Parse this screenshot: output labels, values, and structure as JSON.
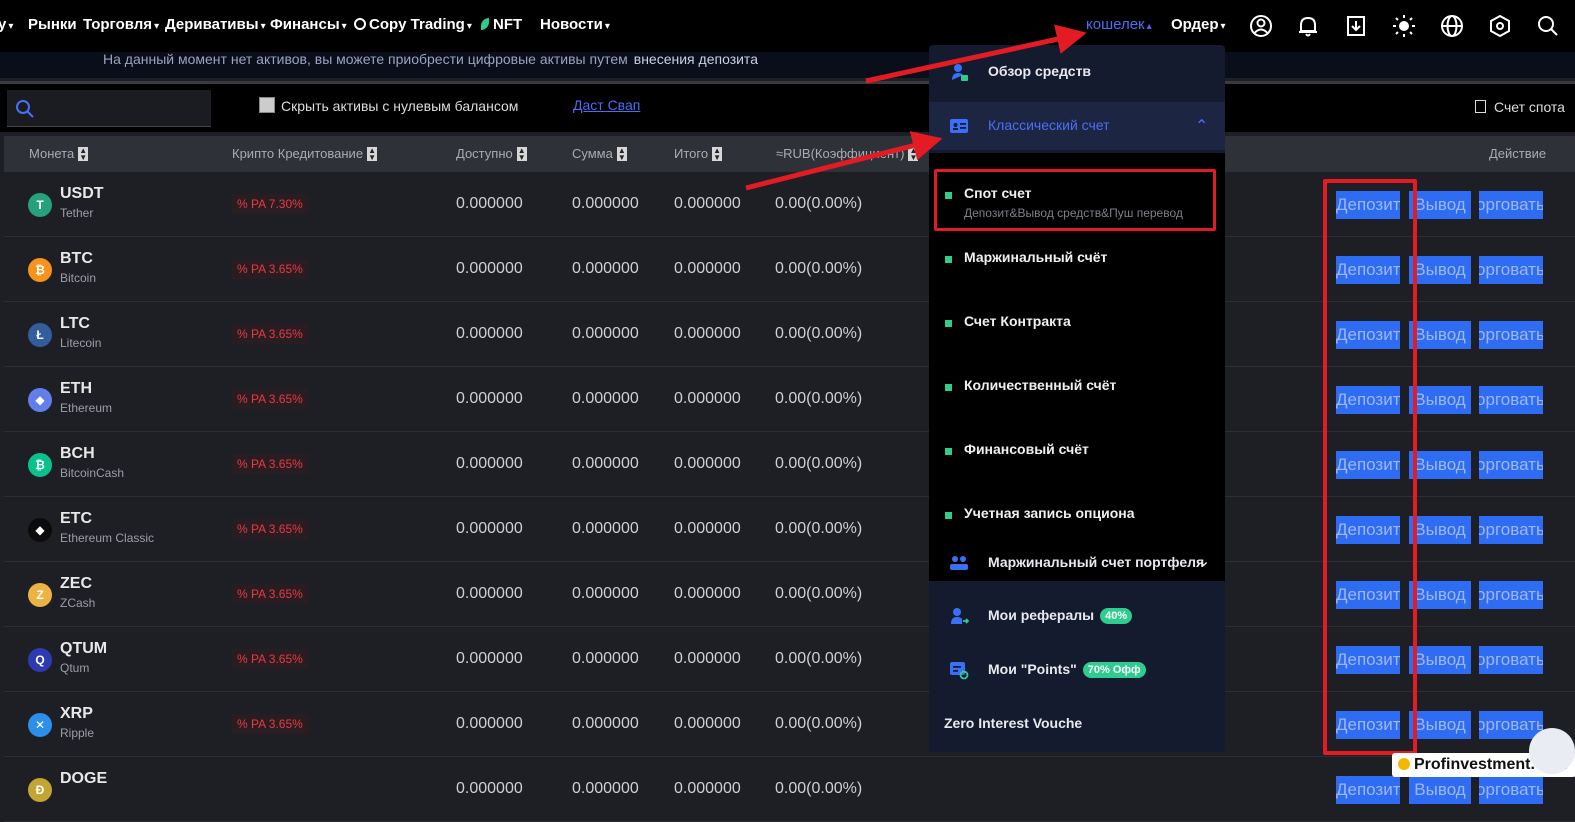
{
  "nav": {
    "items": [
      {
        "label": "у",
        "caret": "▾"
      },
      {
        "label": "Рынки",
        "caret": ""
      },
      {
        "label": "Торговля",
        "caret": "▾"
      },
      {
        "label": "Деривативы",
        "caret": "▾"
      },
      {
        "label": "Финансы",
        "caret": "▾"
      },
      {
        "label": "Copy Trading",
        "caret": "▾"
      },
      {
        "label": "NFT",
        "caret": ""
      },
      {
        "label": "Новости",
        "caret": "▾"
      }
    ],
    "wallet": "кошелек",
    "wallet_caret": "▴",
    "order": "Ордер",
    "order_caret": "▾",
    "icons": [
      "user-icon",
      "bell-icon",
      "download-icon",
      "theme-icon",
      "globe-icon",
      "settings-hex-icon",
      "search-icon"
    ]
  },
  "notice": {
    "text": "На данный момент нет активов, вы можете приобрести цифровые активы путем",
    "link": "внесения депозита"
  },
  "filters": {
    "search_placeholder": "",
    "hide_zero_label": "Скрыть активы с нулевым балансом",
    "dust_swap": "Даст Свап",
    "spot_account_link": "Счет спота"
  },
  "table": {
    "headers": {
      "coin": "Монета",
      "lending": "Крипто Кредитование",
      "available": "Доступно",
      "amount": "Сумма",
      "total": "Итого",
      "rub": "≈RUB(Коэффициент)",
      "action": "Действие"
    },
    "rows": [
      {
        "symbol": "USDT",
        "name": "Tether",
        "rate": "% PA 7.30%",
        "available": "0.000000",
        "amount": "0.000000",
        "total": "0.000000",
        "rub": "0.00(0.00%)",
        "icon_color": "#26a17b",
        "icon_glyph": "T"
      },
      {
        "symbol": "BTC",
        "name": "Bitcoin",
        "rate": "% PA 3.65%",
        "available": "0.000000",
        "amount": "0.000000",
        "total": "0.000000",
        "rub": "0.00(0.00%)",
        "icon_color": "#f7931a",
        "icon_glyph": "₿"
      },
      {
        "symbol": "LTC",
        "name": "Litecoin",
        "rate": "% PA 3.65%",
        "available": "0.000000",
        "amount": "0.000000",
        "total": "0.000000",
        "rub": "0.00(0.00%)",
        "icon_color": "#345d9d",
        "icon_glyph": "Ł"
      },
      {
        "symbol": "ETH",
        "name": "Ethereum",
        "rate": "% PA 3.65%",
        "available": "0.000000",
        "amount": "0.000000",
        "total": "0.000000",
        "rub": "0.00(0.00%)",
        "icon_color": "#627eea",
        "icon_glyph": "◆"
      },
      {
        "symbol": "BCH",
        "name": "BitcoinCash",
        "rate": "% PA 3.65%",
        "available": "0.000000",
        "amount": "0.000000",
        "total": "0.000000",
        "rub": "0.00(0.00%)",
        "icon_color": "#0ac18e",
        "icon_glyph": "₿"
      },
      {
        "symbol": "ETC",
        "name": "Ethereum Classic",
        "rate": "% PA 3.65%",
        "available": "0.000000",
        "amount": "0.000000",
        "total": "0.000000",
        "rub": "0.00(0.00%)",
        "icon_color": "#0b0b0b",
        "icon_glyph": "◆"
      },
      {
        "symbol": "ZEC",
        "name": "ZCash",
        "rate": "% PA 3.65%",
        "available": "0.000000",
        "amount": "0.000000",
        "total": "0.000000",
        "rub": "0.00(0.00%)",
        "icon_color": "#ecb244",
        "icon_glyph": "Z"
      },
      {
        "symbol": "QTUM",
        "name": "Qtum",
        "rate": "% PA 3.65%",
        "available": "0.000000",
        "amount": "0.000000",
        "total": "0.000000",
        "rub": "0.00(0.00%)",
        "icon_color": "#2e3bb0",
        "icon_glyph": "Q"
      },
      {
        "symbol": "XRP",
        "name": "Ripple",
        "rate": "% PA 3.65%",
        "available": "0.000000",
        "amount": "0.000000",
        "total": "0.000000",
        "rub": "0.00(0.00%)",
        "icon_color": "#2d8fe8",
        "icon_glyph": "✕"
      },
      {
        "symbol": "DOGE",
        "name": "",
        "rate": "",
        "available": "0.000000",
        "amount": "0.000000",
        "total": "0.000000",
        "rub": "0.00(0.00%)",
        "icon_color": "#c2a633",
        "icon_glyph": "Ð"
      }
    ],
    "actions": {
      "deposit": "Депозит",
      "withdraw": "Вывод",
      "trade": "Торговать"
    }
  },
  "wallet_menu": {
    "overview": "Обзор средств",
    "classic": "Классический счет",
    "classic_toggle": "⌃",
    "sub_items": [
      {
        "label": "Спот счет",
        "desc": "Депозит&Вывод средств&Пуш перевод"
      },
      {
        "label": "Маржинальный счёт",
        "desc": ""
      },
      {
        "label": "Счет Контракта",
        "desc": ""
      },
      {
        "label": "Количественный счёт",
        "desc": ""
      },
      {
        "label": "Финансовый счёт",
        "desc": ""
      },
      {
        "label": "Учетная запись опциона",
        "desc": ""
      }
    ],
    "portfolio_margin": "Маржинальный счет портфеля",
    "portfolio_caret": "⌄",
    "referrals": "Мои рефералы",
    "referrals_tag": "40%",
    "points": "Мои \"Points\"",
    "points_tag": "70% Офф",
    "zero_interest": "Zero Interest Vouche"
  },
  "colors": {
    "accent": "#4c6ef5",
    "annotation": "#e31b23",
    "negative": "#ea3943",
    "positive": "#2ecc8f",
    "button": "#2f6cf4"
  },
  "watermark": "Profinvestment.com"
}
